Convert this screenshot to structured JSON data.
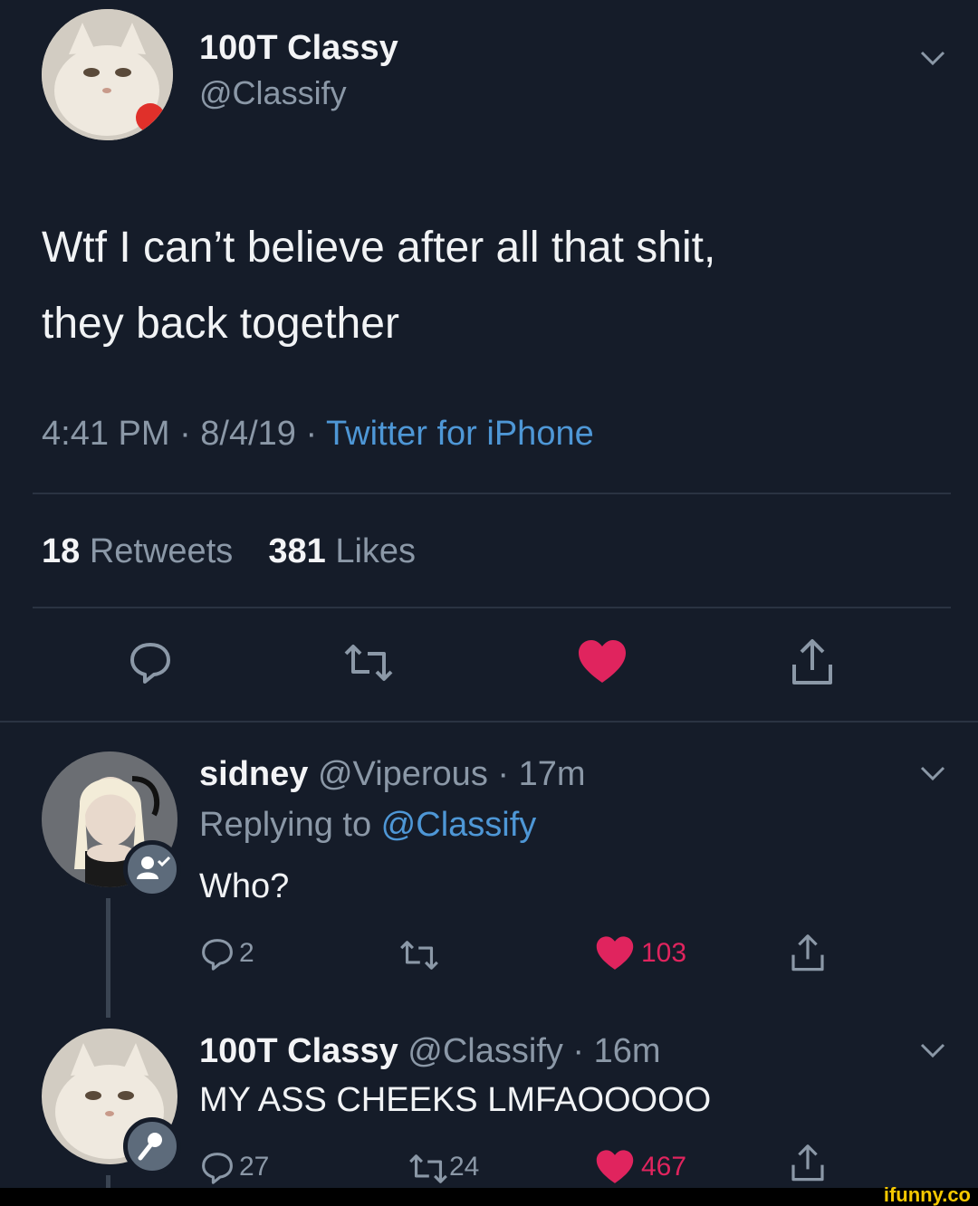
{
  "main_tweet": {
    "display_name": "100T Classy",
    "handle": "@Classify",
    "text_line1": "Wtf I can’t believe after all that shit,",
    "text_line2": "they back together",
    "time": "4:41 PM · 8/4/19 · ",
    "source": "Twitter for iPhone",
    "retweet_count": "18",
    "retweet_label": "Retweets",
    "like_count": "381",
    "like_label": "Likes"
  },
  "replies": [
    {
      "display_name": "sidney",
      "handle_time": "@Viperous · 17m",
      "replying_prefix": "Replying to ",
      "replying_to": "@Classify",
      "text": "Who?",
      "reply_count": "2",
      "retweet_count": "",
      "like_count": "103"
    },
    {
      "display_name": "100T Classy",
      "handle_time": "@Classify · 16m",
      "text": "MY ASS CHEEKS LMFAOOOOO",
      "reply_count": "27",
      "retweet_count": "24",
      "like_count": "467"
    }
  ],
  "watermark": "ifunny.co",
  "colors": {
    "background": "#151c29",
    "accent_blue": "#4e97d6",
    "like_red": "#e0245e",
    "watermark_yellow": "#f6c800"
  },
  "icons": [
    "chevron-down-icon",
    "reply-icon",
    "retweet-icon",
    "heart-icon",
    "share-icon",
    "add-contact-icon",
    "microphone-icon"
  ]
}
